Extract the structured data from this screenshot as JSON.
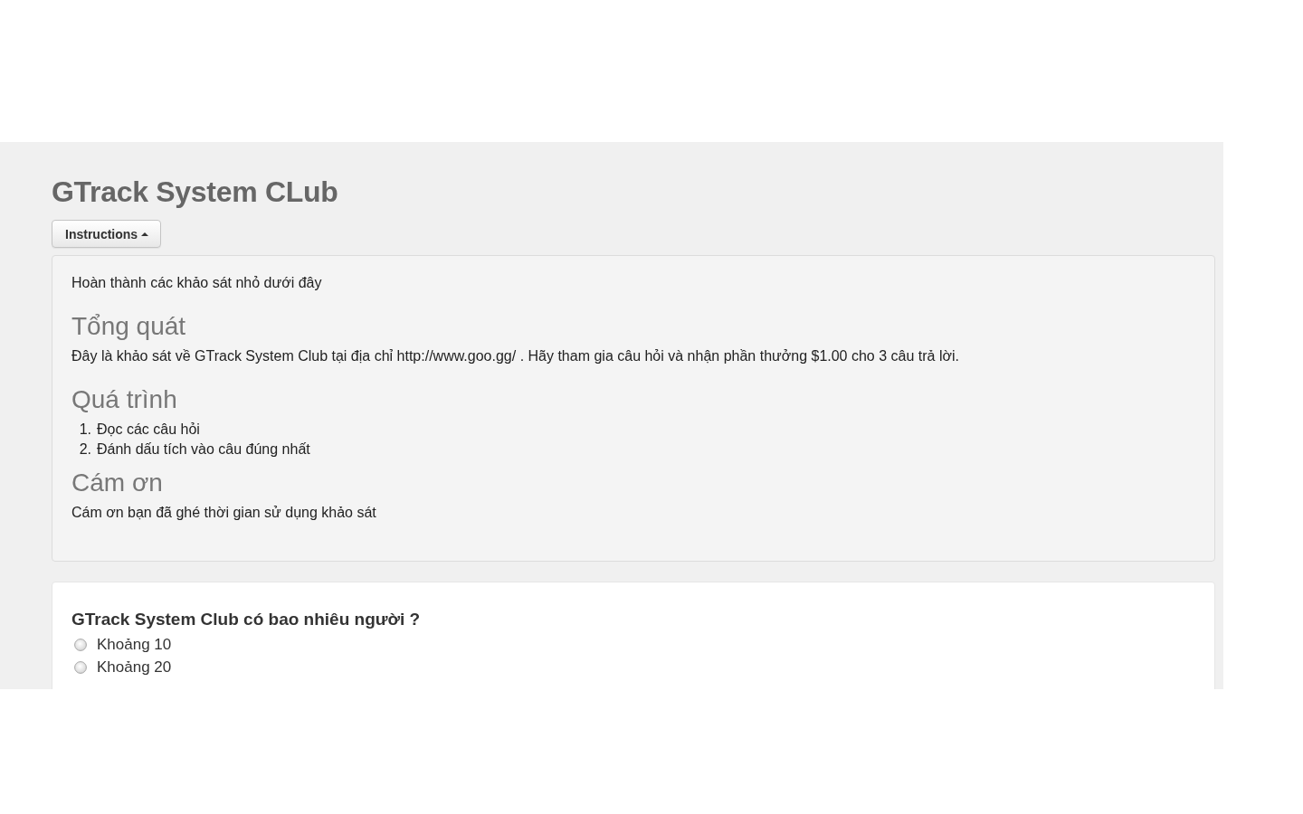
{
  "header": {
    "title": "GTrack System CLub",
    "instructions_button": {
      "label": "Instructions",
      "expanded": true
    }
  },
  "instructions": {
    "intro": "Hoàn thành các khảo sát nhỏ dưới đây",
    "sections": [
      {
        "heading": "Tổng quát",
        "kind": "paragraph",
        "text": "Đây là khảo sát về GTrack System Club tại địa chỉ http://www.goo.gg/ . Hãy tham gia câu hỏi và nhận phần thưởng $1.00 cho 3 câu trả lời."
      },
      {
        "heading": "Quá trình",
        "kind": "list",
        "items": [
          {
            "number": "1.",
            "text": "Đọc các câu hỏi"
          },
          {
            "number": "2.",
            "text": "Đánh dấu tích vào câu đúng nhất"
          }
        ]
      },
      {
        "heading": "Cám ơn",
        "kind": "paragraph",
        "text": "Cám ơn bạn đã ghé thời gian sử dụng khảo sát"
      }
    ]
  },
  "question": {
    "title": "GTrack System Club có bao nhiêu người ?",
    "options": [
      {
        "label": "Khoảng 10",
        "selected": false
      },
      {
        "label": "Khoảng 20",
        "selected": false
      }
    ]
  }
}
